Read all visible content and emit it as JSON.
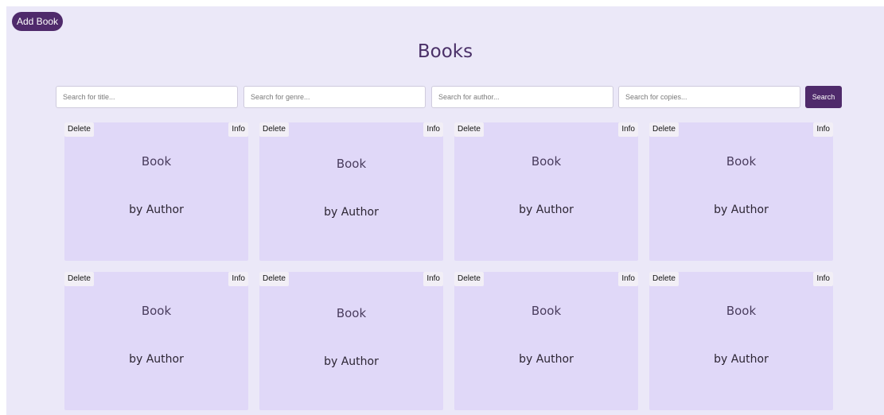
{
  "toolbar": {
    "add_book_label": "Add Book"
  },
  "page": {
    "title": "Books"
  },
  "search": {
    "title_placeholder": "Search for title...",
    "genre_placeholder": "Search for genre...",
    "author_placeholder": "Search for author...",
    "copies_placeholder": "Search for copies...",
    "button_label": "Search"
  },
  "books": [
    {
      "title": "Book",
      "author": "by Author",
      "delete_label": "Delete",
      "info_label": "Info"
    },
    {
      "title": "Book",
      "author": "by Author",
      "delete_label": "Delete",
      "info_label": "Info"
    },
    {
      "title": "Book",
      "author": "by Author",
      "delete_label": "Delete",
      "info_label": "Info"
    },
    {
      "title": "Book",
      "author": "by Author",
      "delete_label": "Delete",
      "info_label": "Info"
    },
    {
      "title": "Book",
      "author": "by Author",
      "delete_label": "Delete",
      "info_label": "Info"
    },
    {
      "title": "Book",
      "author": "by Author",
      "delete_label": "Delete",
      "info_label": "Info"
    },
    {
      "title": "Book",
      "author": "by Author",
      "delete_label": "Delete",
      "info_label": "Info"
    },
    {
      "title": "Book",
      "author": "by Author",
      "delete_label": "Delete",
      "info_label": "Info"
    }
  ],
  "colors": {
    "accent": "#4f2a6b",
    "background": "#ebe8f8",
    "card": "#e0d8f8"
  }
}
